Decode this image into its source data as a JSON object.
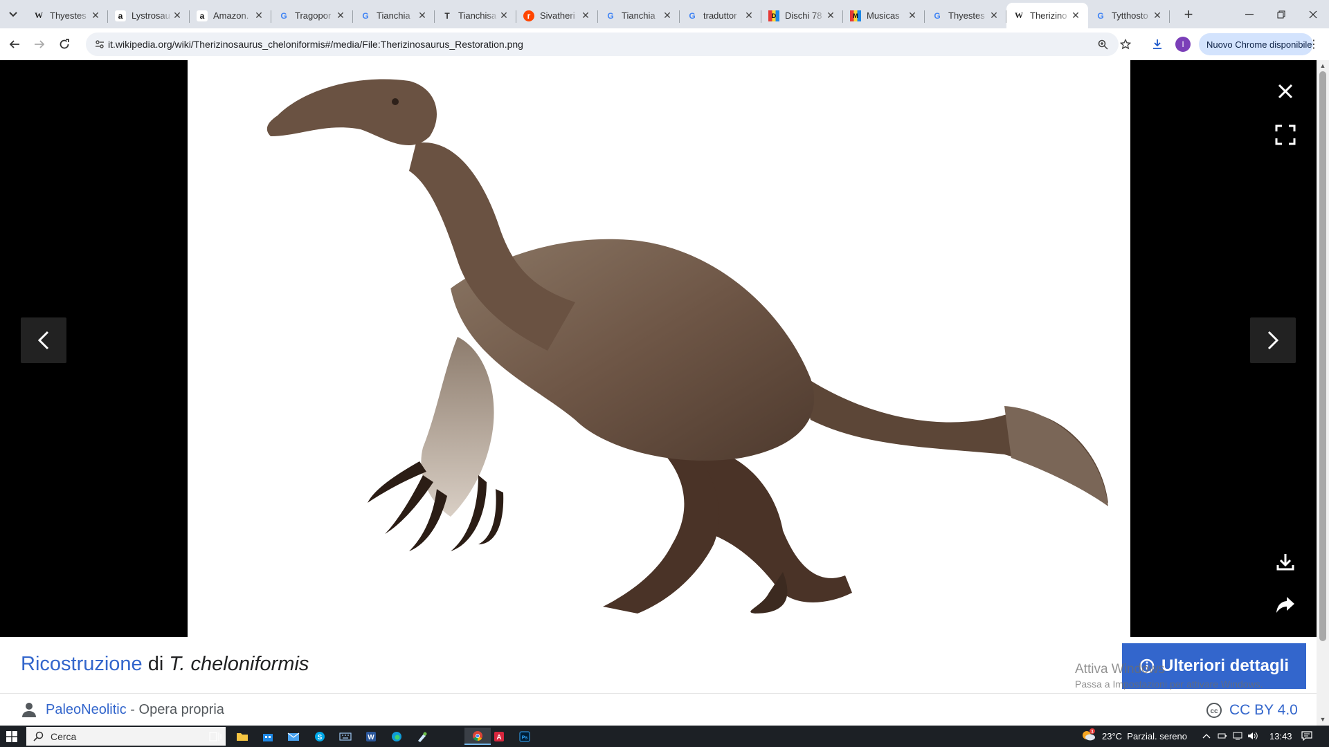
{
  "tabs": [
    {
      "title": "Thyestes",
      "favicon": "W"
    },
    {
      "title": "Lystrosau",
      "favicon": "a"
    },
    {
      "title": "Amazon.",
      "favicon": "a"
    },
    {
      "title": "Tragopor",
      "favicon": "G"
    },
    {
      "title": "Tianchia",
      "favicon": "G"
    },
    {
      "title": "Tianchisa",
      "favicon": "T"
    },
    {
      "title": "Sivatheri",
      "favicon": "r"
    },
    {
      "title": "Tianchia",
      "favicon": "G"
    },
    {
      "title": "traduttor",
      "favicon": "G"
    },
    {
      "title": "Dischi 78",
      "favicon": "D"
    },
    {
      "title": "Musicas",
      "favicon": "M"
    },
    {
      "title": "Thyestes",
      "favicon": "G"
    },
    {
      "title": "Therizino",
      "favicon": "W",
      "active": true
    },
    {
      "title": "Tytthosto",
      "favicon": "G"
    }
  ],
  "toolbar": {
    "url": "it.wikipedia.org/wiki/Therizinosaurus_cheloniformis#/media/File:Therizinosaurus_Restoration.png",
    "update_label": "Nuovo Chrome disponibile",
    "profile_initial": "I"
  },
  "caption": {
    "title_link": "Ricostruzione",
    "title_mid": " di ",
    "title_italic": "T. cheloniformis",
    "details_label": "Ulteriori dettagli",
    "author_link": "PaleoNeolitic",
    "author_rest": " - Opera propria",
    "license": "CC BY 4.0"
  },
  "watermark": {
    "line1": "Attiva Windows",
    "line2": "Passa a Impostazioni per attivare Windows."
  },
  "taskbar": {
    "search_placeholder": "Cerca",
    "weather": "23°C  Parzial. sereno",
    "weather_badge": "1",
    "time": "13:43"
  },
  "colors": {
    "wiki_blue": "#3366cc",
    "tabstrip": "#dfe3ea",
    "taskbar": "#1c2025"
  }
}
